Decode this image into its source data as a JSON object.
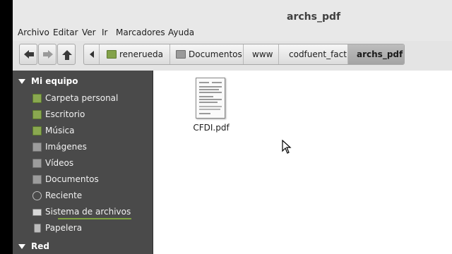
{
  "window": {
    "title": "archs_pdf"
  },
  "menu": [
    "Archivo",
    "Editar",
    "Ver",
    "Ir",
    "Marcadores",
    "Ayuda"
  ],
  "breadcrumbs": [
    "renerueda",
    "Documentos",
    "www",
    "codfuent_fact",
    "archs_pdf"
  ],
  "sidebar": {
    "sections": [
      {
        "title": "Mi equipo",
        "items": [
          {
            "label": "Carpeta personal",
            "icon": "home-folder-icon"
          },
          {
            "label": "Escritorio",
            "icon": "desktop-folder-icon"
          },
          {
            "label": "Música",
            "icon": "music-folder-icon"
          },
          {
            "label": "Imágenes",
            "icon": "pictures-folder-icon"
          },
          {
            "label": "Vídeos",
            "icon": "videos-folder-icon"
          },
          {
            "label": "Documentos",
            "icon": "documents-folder-icon"
          },
          {
            "label": "Reciente",
            "icon": "recent-icon"
          },
          {
            "label": "Sistema de archivos",
            "icon": "drive-icon"
          },
          {
            "label": "Papelera",
            "icon": "trash-icon"
          }
        ]
      },
      {
        "title": "Red",
        "items": []
      }
    ]
  },
  "files": [
    {
      "name": "CFDI.pdf",
      "icon": "pdf-thumbnail-icon"
    }
  ],
  "colors": {
    "sidebar_bg": "#4a4a4a",
    "accent_green": "#7fa340",
    "active_crumb": "#a4a4a4"
  }
}
